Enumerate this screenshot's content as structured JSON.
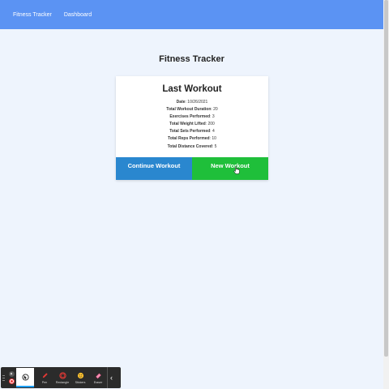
{
  "nav": {
    "links": [
      "Fitness Tracker",
      "Dashboard"
    ]
  },
  "page": {
    "title": "Fitness Tracker"
  },
  "card": {
    "title": "Last Workout",
    "stats": [
      {
        "label": "Date",
        "value": "10/26/2021"
      },
      {
        "label": "Total Workout Duration",
        "value": "20"
      },
      {
        "label": "Exercises Performed",
        "value": "3"
      },
      {
        "label": "Total Weight Lifted",
        "value": "200"
      },
      {
        "label": "Total Sets Performed",
        "value": "4"
      },
      {
        "label": "Total Reps Performed",
        "value": "10"
      },
      {
        "label": "Total Distance Covered",
        "value": "5"
      }
    ],
    "continue_label": "Continue Workout",
    "new_label": "New Workout"
  },
  "toolbar": {
    "tools": [
      {
        "label": "Pen",
        "icon": "pen-icon"
      },
      {
        "label": "Rectangle",
        "icon": "rectangle-icon"
      },
      {
        "label": "Stickers",
        "icon": "sticker-icon"
      },
      {
        "label": "Eraser",
        "icon": "eraser-icon"
      }
    ],
    "chevron": "‹",
    "close_glyph": "×"
  },
  "colors": {
    "navbar": "#5b93f3",
    "background": "#eef4fd",
    "continue_button": "#2a87cf",
    "new_button": "#1fbf3a"
  }
}
